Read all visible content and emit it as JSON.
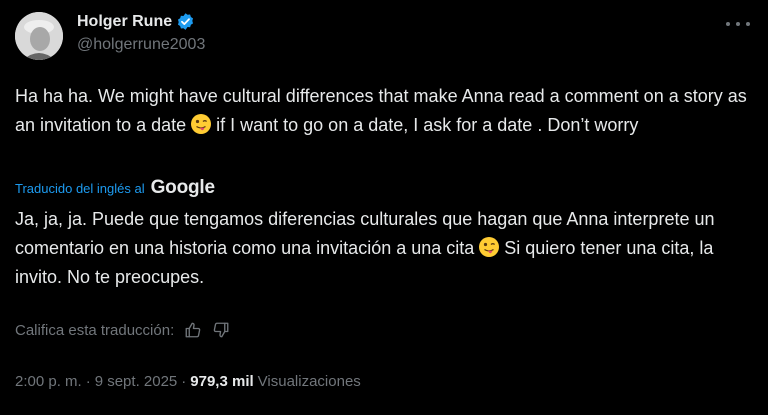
{
  "author": {
    "name": "Holger Rune",
    "handle": "@holgerrune2003"
  },
  "tweet": {
    "text_part1": "Ha ha ha. We might have cultural differences that make Anna read a comment on a story as an invitation to a date",
    "text_part2": "if I want to go on a date, I ask for a date . Don’t worry",
    "translated_from": "Traducido del inglés al",
    "translator": "Google",
    "translation_part1": "Ja, ja, ja. Puede que tengamos diferencias culturales que hagan que Anna interprete un comentario en una historia como una invitación a una cita",
    "translation_part2": "Si quiero tener una cita, la invito. No te preocupes.",
    "rate_label": "Califica esta traducción:",
    "time": "2:00 p. m.",
    "separator": "·",
    "date": "9 sept. 2025",
    "views_count": "979,3 mil",
    "views_label": "Visualizaciones"
  },
  "icons": {
    "verified": "verified-badge-icon",
    "more": "more-options-icon",
    "thumbs_up": "thumbs-up-icon",
    "thumbs_down": "thumbs-down-icon",
    "emoji": "winking-face-with-tongue-emoji"
  },
  "colors": {
    "background": "#000000",
    "text": "#e7e9ea",
    "secondary": "#71767b",
    "accent": "#1d9bf0"
  }
}
